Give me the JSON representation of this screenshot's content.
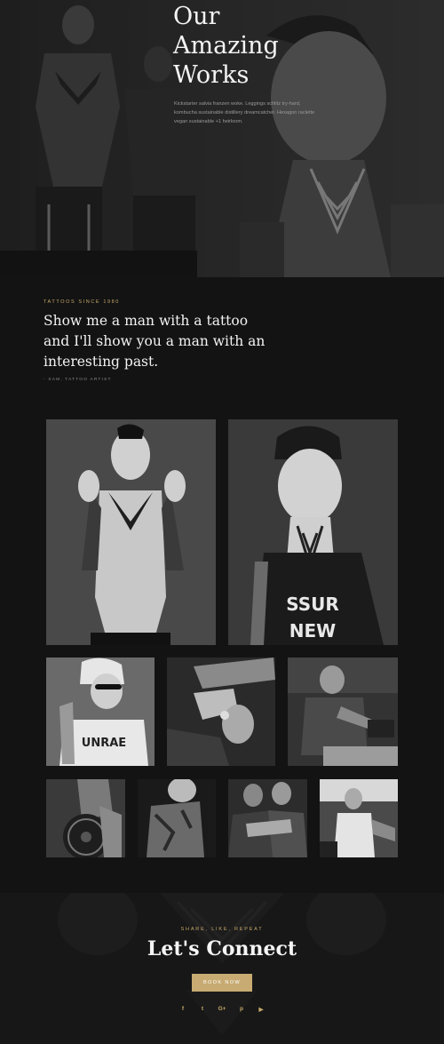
{
  "hero": {
    "title_lines": [
      "Our",
      "Amazing",
      "Works"
    ],
    "body": "Kickstarter salvia franzen woke. Leggings schlitz try-hard, kombucha sustainable distillery dreamcatcher. Hexagon raclette vegan sustainable +1 heirloom."
  },
  "quote_section": {
    "eyebrow": "TATTOOS SINCE 1980",
    "quote": "Show me a man with a tattoo and I'll show you a man with an interesting past.",
    "attribution": "- SAM, TATTOO ARTIST"
  },
  "gallery": {
    "photos": [
      "shirtless-tattooed-man-photo",
      "man-in-cap-neck-tattoo-photo",
      "woman-smoking-towel-photo",
      "tattooed-hands-ring-photo",
      "tattoo-artist-working-photo",
      "tattooed-arm-weight-plate-photo",
      "tattooed-man-portrait-photo",
      "couple-tattooed-arms-photo",
      "tattoo-artist-studio-photo"
    ]
  },
  "connect": {
    "eyebrow": "SHARE, LIKE, REPEAT",
    "title": "Let's Connect",
    "button_label": "BOOK NOW",
    "socials": [
      {
        "icon": "facebook-icon",
        "glyph": "f"
      },
      {
        "icon": "twitter-icon",
        "glyph": "t"
      },
      {
        "icon": "google-plus-icon",
        "glyph": "G+"
      },
      {
        "icon": "pinterest-icon",
        "glyph": "p"
      },
      {
        "icon": "youtube-icon",
        "glyph": "▶"
      }
    ]
  },
  "colors": {
    "accent": "#c7ab72",
    "background": "#131313"
  }
}
